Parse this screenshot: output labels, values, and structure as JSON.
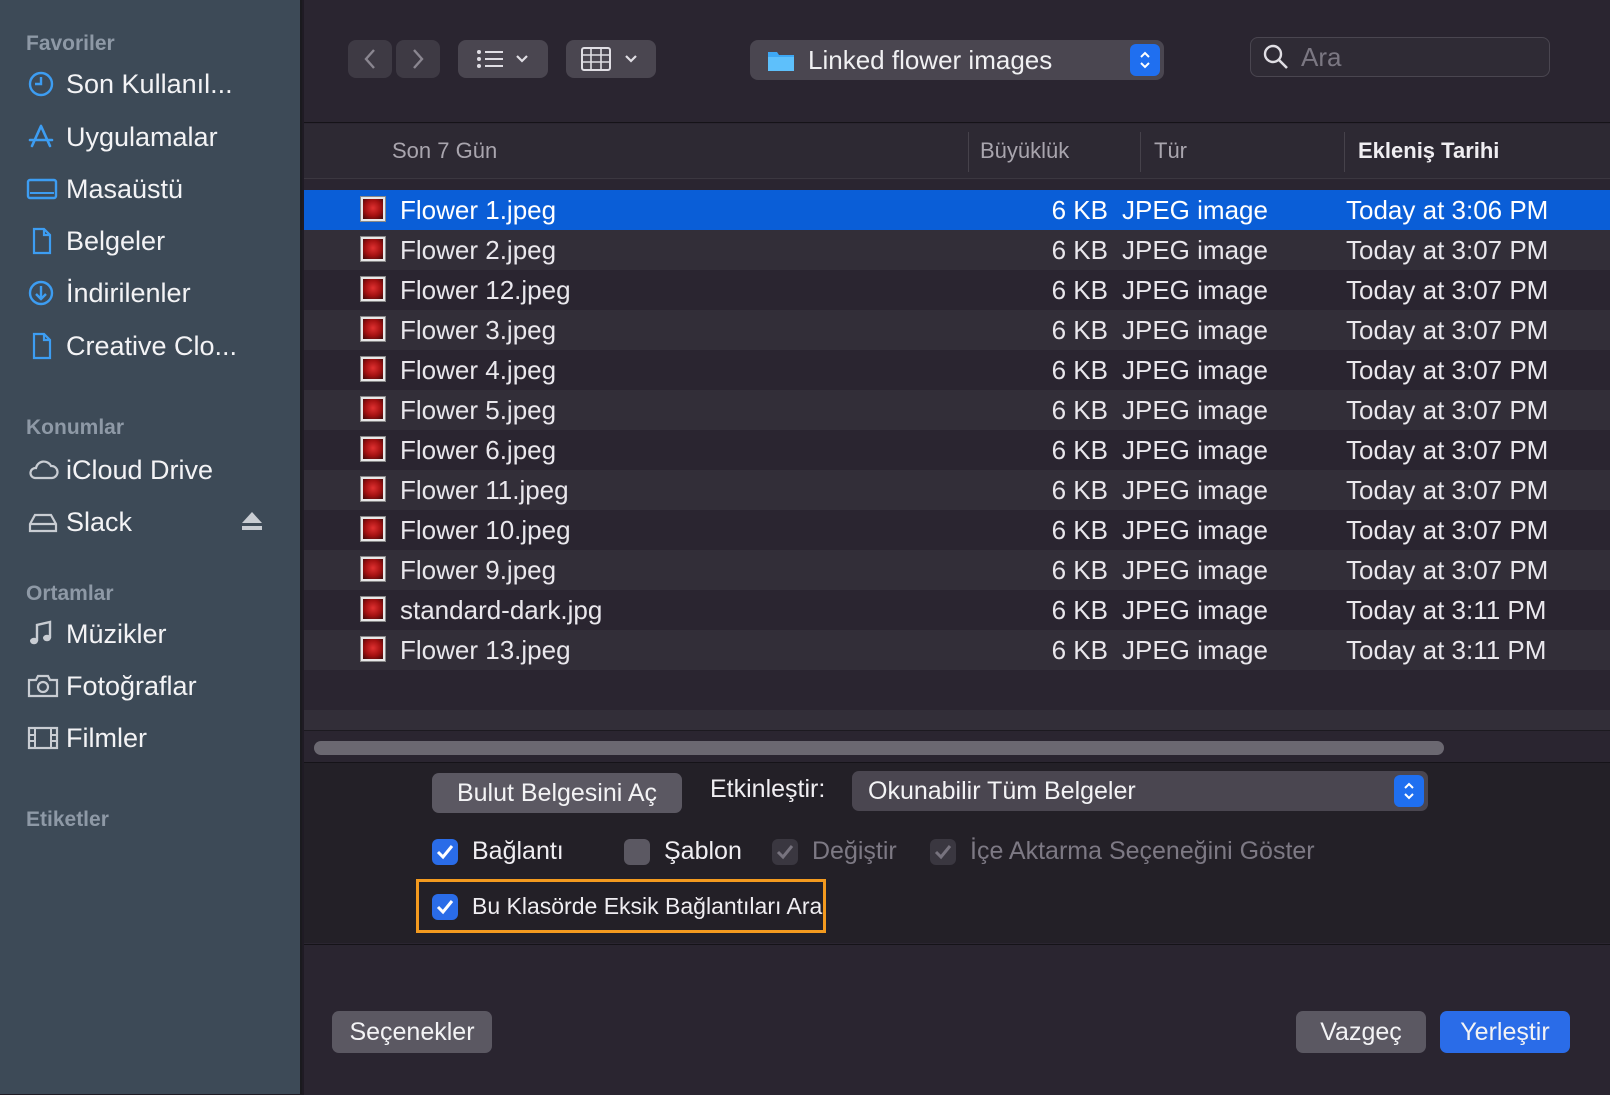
{
  "sidebar": {
    "sections": {
      "favorites": "Favoriler",
      "locations": "Konumlar",
      "media": "Ortamlar",
      "tags": "Etiketler"
    },
    "favorites": [
      {
        "label": "Son Kullanıl...",
        "icon": "clock-icon"
      },
      {
        "label": "Uygulamalar",
        "icon": "apps-icon"
      },
      {
        "label": "Masaüstü",
        "icon": "desktop-icon"
      },
      {
        "label": "Belgeler",
        "icon": "document-icon"
      },
      {
        "label": "İndirilenler",
        "icon": "download-icon"
      },
      {
        "label": "Creative Clo...",
        "icon": "document-icon"
      }
    ],
    "locations": [
      {
        "label": "iCloud Drive",
        "icon": "cloud-icon"
      },
      {
        "label": "Slack",
        "icon": "drive-icon"
      }
    ],
    "media": [
      {
        "label": "Müzikler",
        "icon": "music-icon"
      },
      {
        "label": "Fotoğraflar",
        "icon": "camera-icon"
      },
      {
        "label": "Filmler",
        "icon": "film-icon"
      }
    ]
  },
  "toolbar": {
    "location": "Linked flower images",
    "search_placeholder": "Ara"
  },
  "table": {
    "headers": {
      "name": "Son 7 Gün",
      "size": "Büyüklük",
      "type": "Tür",
      "date": "Ekleniş Tarihi"
    },
    "rows": [
      {
        "name": "Flower 1.jpeg",
        "size": "6 KB",
        "type": "JPEG image",
        "date": "Today at 3:06 PM",
        "selected": true
      },
      {
        "name": "Flower 2.jpeg",
        "size": "6 KB",
        "type": "JPEG image",
        "date": "Today at 3:07 PM"
      },
      {
        "name": "Flower 12.jpeg",
        "size": "6 KB",
        "type": "JPEG image",
        "date": "Today at 3:07 PM"
      },
      {
        "name": "Flower 3.jpeg",
        "size": "6 KB",
        "type": "JPEG image",
        "date": "Today at 3:07 PM"
      },
      {
        "name": "Flower 4.jpeg",
        "size": "6 KB",
        "type": "JPEG image",
        "date": "Today at 3:07 PM"
      },
      {
        "name": "Flower 5.jpeg",
        "size": "6 KB",
        "type": "JPEG image",
        "date": "Today at 3:07 PM"
      },
      {
        "name": "Flower 6.jpeg",
        "size": "6 KB",
        "type": "JPEG image",
        "date": "Today at 3:07 PM"
      },
      {
        "name": "Flower 11.jpeg",
        "size": "6 KB",
        "type": "JPEG image",
        "date": "Today at 3:07 PM"
      },
      {
        "name": "Flower 10.jpeg",
        "size": "6 KB",
        "type": "JPEG image",
        "date": "Today at 3:07 PM"
      },
      {
        "name": "Flower 9.jpeg",
        "size": "6 KB",
        "type": "JPEG image",
        "date": "Today at 3:07 PM"
      },
      {
        "name": "standard-dark.jpg",
        "size": "6 KB",
        "type": "JPEG image",
        "date": "Today at 3:11 PM"
      },
      {
        "name": "Flower 13.jpeg",
        "size": "6 KB",
        "type": "JPEG image",
        "date": "Today at 3:11 PM"
      }
    ]
  },
  "options": {
    "cloud_button": "Bulut Belgesini Aç",
    "enable_label": "Etkinleştir:",
    "enable_value": "Okunabilir Tüm Belgeler",
    "link_label": "Bağlantı",
    "link_checked": true,
    "template_label": "Şablon",
    "template_checked": false,
    "replace_label": "Değiştir",
    "import_label": "İçe Aktarma Seçeneğini Göster",
    "search_missing_label": "Bu Klasörde Eksik Bağlantıları Ara",
    "search_missing_checked": true
  },
  "footer": {
    "options_button": "Seçenekler",
    "cancel_button": "Vazgeç",
    "place_button": "Yerleştir"
  },
  "colors": {
    "accent": "#2a6ce8",
    "selection": "#0a5ed7",
    "highlight": "#f39a1f"
  }
}
